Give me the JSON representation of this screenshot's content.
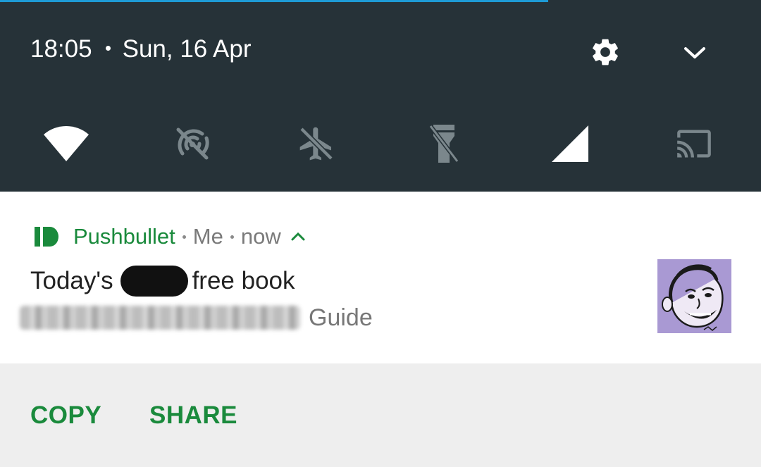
{
  "status_bar": {
    "time": "18:05",
    "date": "Sun, 16 Apr",
    "settings_icon": "gear-icon",
    "expand_icon": "chevron-down-icon"
  },
  "quick_settings": [
    {
      "name": "wifi",
      "icon": "wifi-icon",
      "active": true
    },
    {
      "name": "hotspot",
      "icon": "hotspot-off-icon",
      "active": false
    },
    {
      "name": "airplane",
      "icon": "airplane-icon",
      "active": false
    },
    {
      "name": "flashlight",
      "icon": "flashlight-icon",
      "active": false
    },
    {
      "name": "cellular",
      "icon": "signal-icon",
      "active": true
    },
    {
      "name": "cast",
      "icon": "cast-icon",
      "active": false
    }
  ],
  "notification": {
    "app_name": "Pushbullet",
    "sender": "Me",
    "time": "now",
    "title_prefix": "Today's",
    "title_suffix": "free book",
    "text_suffix": "Guide",
    "accent_color": "#1a8a3c",
    "thumbnail": "caricature-avatar"
  },
  "actions": {
    "copy": "COPY",
    "share": "SHARE"
  },
  "colors": {
    "shade_bg": "#263238",
    "active_icon": "#ffffff",
    "inactive_icon": "#7b878c",
    "accent": "#1a8a3c",
    "progress": "#1e9bd6"
  }
}
